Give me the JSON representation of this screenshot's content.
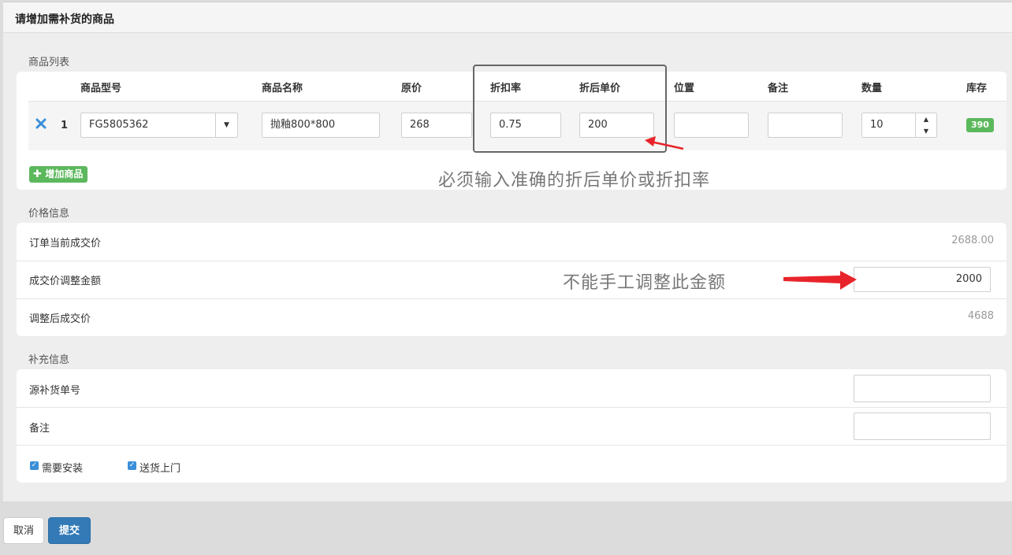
{
  "modal": {
    "title": "请增加需补货的商品"
  },
  "product_section": {
    "label": "商品列表",
    "headers": {
      "model": "商品型号",
      "name": "商品名称",
      "orig_price": "原价",
      "discount": "折扣率",
      "discount_price": "折后单价",
      "location": "位置",
      "note": "备注",
      "qty": "数量",
      "stock": "库存"
    },
    "row": {
      "index": "1",
      "model": "FG5805362",
      "name": "抛釉800*800",
      "orig_price": "268",
      "discount": "0.75",
      "discount_price": "200",
      "location": "",
      "note": "",
      "qty": "10",
      "stock": "390"
    },
    "add_button": "增加商品",
    "annotation": "必须输入准确的折后单价或折扣率"
  },
  "price_section": {
    "label": "价格信息",
    "current_label": "订单当前成交价",
    "current_value": "2688.00",
    "adjust_label": "成交价调整金额",
    "adjust_value": "2000",
    "final_label": "调整后成交价",
    "final_value": "4688",
    "annotation": "不能手工调整此金额"
  },
  "extra_section": {
    "label": "补充信息",
    "source_label": "源补货单号",
    "source_value": "",
    "note_label": "备注",
    "note_value": "",
    "install_label": "需要安装",
    "install_checked": true,
    "delivery_label": "送货上门",
    "delivery_checked": true
  },
  "footer": {
    "cancel": "取消",
    "submit": "提交"
  },
  "colors": {
    "primary": "#337ab7",
    "success": "#5cb85c",
    "annotation_arrow": "#e8242a"
  },
  "icons": {
    "remove": "close-icon",
    "add": "plus-icon",
    "select": "caret-down-icon"
  }
}
